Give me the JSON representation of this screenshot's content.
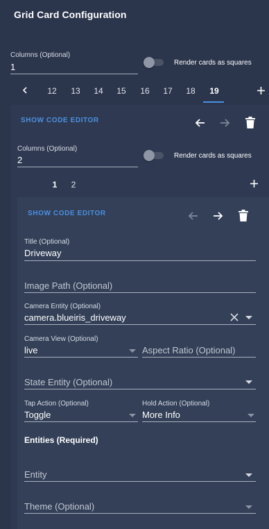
{
  "header": {
    "title": "Grid Card Configuration"
  },
  "outer": {
    "columns_label": "Columns (Optional)",
    "columns_value": "1",
    "square_toggle_label": "Render cards as squares",
    "tabs": [
      "12",
      "13",
      "14",
      "15",
      "16",
      "17",
      "18",
      "19"
    ],
    "active_tab": "19"
  },
  "card1": {
    "code_editor_label": "SHOW CODE EDITOR",
    "columns_label": "Columns (Optional)",
    "columns_value": "2",
    "square_toggle_label": "Render cards as squares",
    "tabs": [
      "1",
      "2"
    ]
  },
  "card2": {
    "code_editor_label": "SHOW CODE EDITOR",
    "title_label": "Title (Optional)",
    "title_value": "Driveway",
    "image_path_placeholder": "Image Path (Optional)",
    "camera_entity_label": "Camera Entity (Optional)",
    "camera_entity_value": "camera.blueiris_driveway",
    "camera_view_label": "Camera View (Optional)",
    "camera_view_value": "live",
    "aspect_ratio_placeholder": "Aspect Ratio (Optional)",
    "state_entity_placeholder": "State Entity (Optional)",
    "tap_action_label": "Tap Action (Optional)",
    "tap_action_value": "Toggle",
    "hold_action_label": "Hold Action (Optional)",
    "hold_action_value": "More Info",
    "entities_heading": "Entities (Required)",
    "entity_placeholder": "Entity",
    "theme_placeholder": "Theme (Optional)"
  },
  "colors": {
    "accent": "#4b8fe0",
    "background": "#2b354c",
    "panel": "#2f3a52",
    "inner_panel": "#334058"
  }
}
